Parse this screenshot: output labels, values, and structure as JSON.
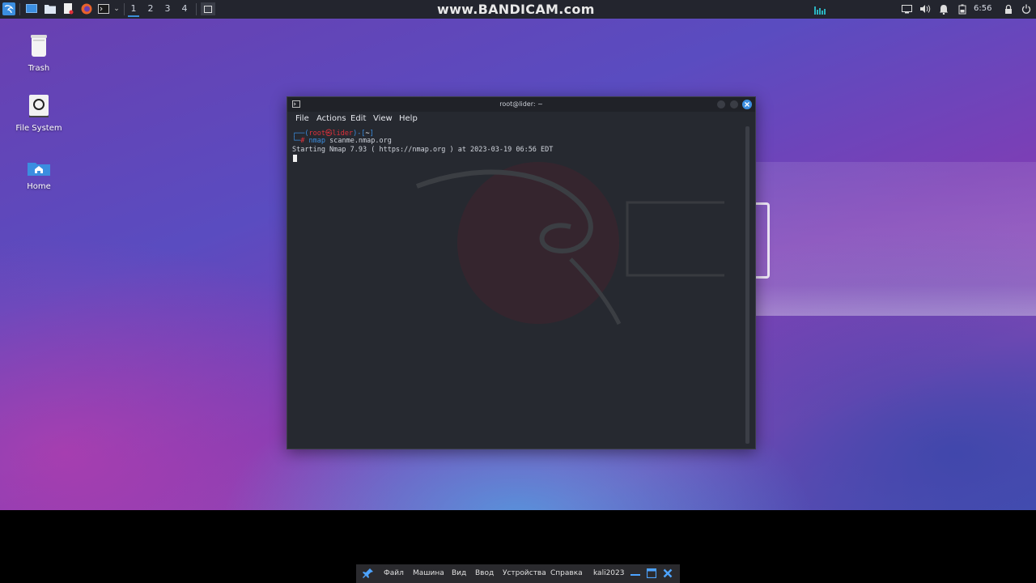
{
  "top_panel": {
    "workspaces": [
      "1",
      "2",
      "3",
      "4"
    ],
    "watermark": "www.BANDICAM.com",
    "clock": "6:56"
  },
  "desktop_icons": [
    {
      "label": "Trash",
      "icon": "trash-icon"
    },
    {
      "label": "File System",
      "icon": "drive-icon"
    },
    {
      "label": "Home",
      "icon": "home-folder-icon"
    }
  ],
  "terminal": {
    "title": "root@lider: ~",
    "menu": [
      "File",
      "Actions",
      "Edit",
      "View",
      "Help"
    ],
    "prompt_user": "root",
    "prompt_at": "㉿",
    "prompt_host": "lider",
    "prompt_dir": "~",
    "prompt_symbol": "#",
    "command_name": "nmap",
    "command_args": "scanme.nmap.org",
    "output_line": "Starting Nmap 7.93 ( https://nmap.org ) at 2023-03-19 06:56 EDT"
  },
  "vbox_bar": {
    "menu": [
      "Файл",
      "Машина",
      "Вид",
      "Ввод",
      "Устройства",
      "Справка"
    ],
    "vm_name": "kali2023"
  },
  "colors": {
    "accent": "#3a8fd8",
    "prompt_red": "#e0313b",
    "prompt_blue": "#3b8ee0",
    "terminal_bg": "#262930"
  }
}
